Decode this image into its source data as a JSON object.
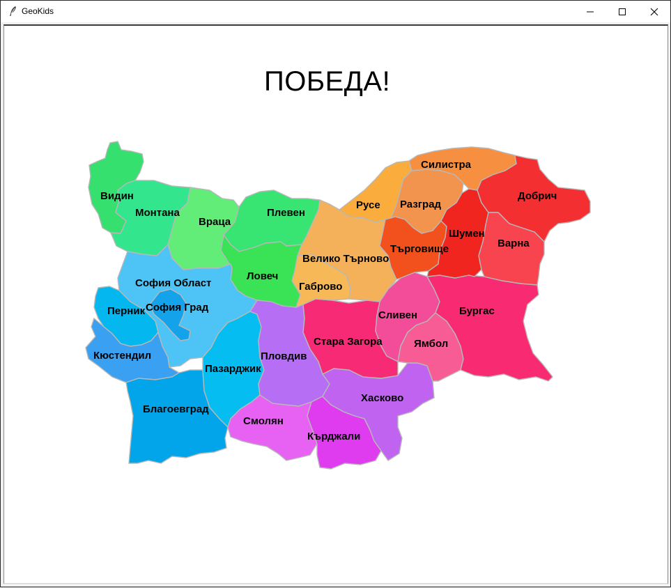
{
  "window": {
    "title": "GeoKids",
    "controls": {
      "minimize": "minimize-icon",
      "maximize": "maximize-icon",
      "close": "close-icon"
    }
  },
  "status_text": "ПОБЕДА!",
  "regions": [
    {
      "name": "Видин",
      "color": "#35e06e"
    },
    {
      "name": "Монтана",
      "color": "#33e68e"
    },
    {
      "name": "Враца",
      "color": "#62ec78"
    },
    {
      "name": "Плевен",
      "color": "#38e472"
    },
    {
      "name": "Ловеч",
      "color": "#3ae256"
    },
    {
      "name": "София Област",
      "color": "#4dc4f5"
    },
    {
      "name": "София Град",
      "color": "#14a3ea"
    },
    {
      "name": "Перник",
      "color": "#04b7ef"
    },
    {
      "name": "Кюстендил",
      "color": "#3aa0f2"
    },
    {
      "name": "Благоевград",
      "color": "#03a5ea"
    },
    {
      "name": "Пазарджик",
      "color": "#06bdf2"
    },
    {
      "name": "Пловдив",
      "color": "#b66ef5"
    },
    {
      "name": "Смолян",
      "color": "#e762f2"
    },
    {
      "name": "Кърджали",
      "color": "#df3cf0"
    },
    {
      "name": "Хасково",
      "color": "#c063f0"
    },
    {
      "name": "Стара Загора",
      "color": "#f72a76"
    },
    {
      "name": "Сливен",
      "color": "#f34c98"
    },
    {
      "name": "Ямбол",
      "color": "#f85c94"
    },
    {
      "name": "Бургас",
      "color": "#f82b72"
    },
    {
      "name": "Габрово",
      "color": "#f7b957"
    },
    {
      "name": "Велико Търново",
      "color": "#f5b15a"
    },
    {
      "name": "Русе",
      "color": "#faad3c"
    },
    {
      "name": "Разград",
      "color": "#f2934e"
    },
    {
      "name": "Силистра",
      "color": "#f69040"
    },
    {
      "name": "Търговище",
      "color": "#f2511d"
    },
    {
      "name": "Шумен",
      "color": "#f0251f"
    },
    {
      "name": "Добрич",
      "color": "#f42f32"
    },
    {
      "name": "Варна",
      "color": "#f7444f"
    }
  ]
}
